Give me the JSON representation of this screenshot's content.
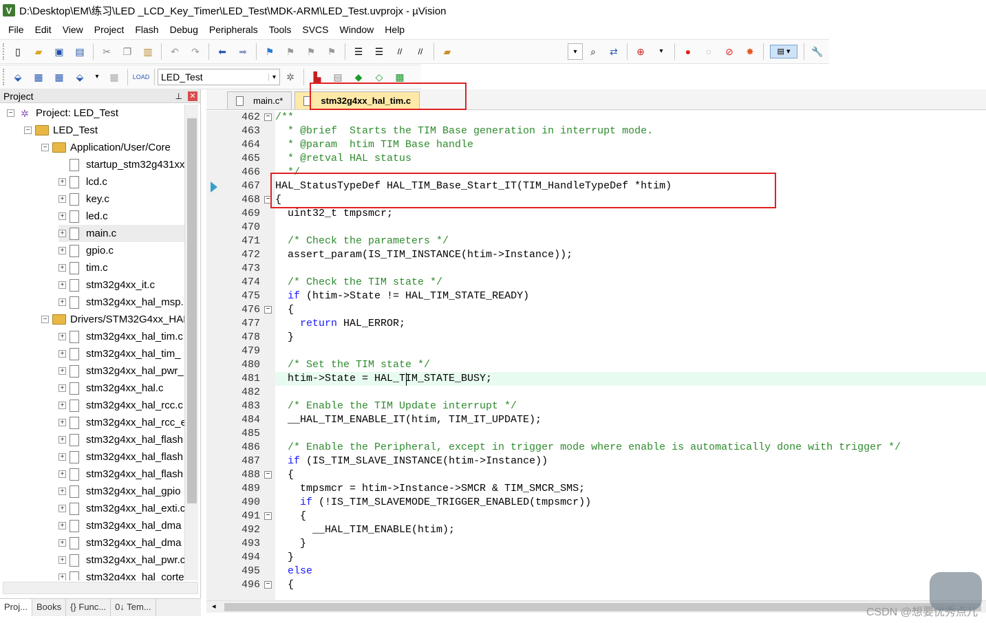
{
  "title": "D:\\Desktop\\EM\\练习\\LED _LCD_Key_Timer\\LED_Test\\MDK-ARM\\LED_Test.uvprojx - µVision",
  "app_icon": "V",
  "menu": [
    "File",
    "Edit",
    "View",
    "Project",
    "Flash",
    "Debug",
    "Peripherals",
    "Tools",
    "SVCS",
    "Window",
    "Help"
  ],
  "toolbar2": {
    "target": "LED_Test"
  },
  "project_panel": {
    "title": "Project",
    "tree": [
      {
        "label": "Project: LED_Test",
        "level": 0,
        "kind": "project",
        "exp": "−"
      },
      {
        "label": "LED_Test",
        "level": 1,
        "kind": "target",
        "exp": "−"
      },
      {
        "label": "Application/User/Core",
        "level": 2,
        "kind": "folder",
        "exp": "−"
      },
      {
        "label": "startup_stm32g431xx",
        "level": 3,
        "kind": "file",
        "exp": ""
      },
      {
        "label": "lcd.c",
        "level": 3,
        "kind": "file",
        "exp": "+"
      },
      {
        "label": "key.c",
        "level": 3,
        "kind": "file",
        "exp": "+"
      },
      {
        "label": "led.c",
        "level": 3,
        "kind": "file",
        "exp": "+"
      },
      {
        "label": "main.c",
        "level": 3,
        "kind": "file",
        "exp": "+",
        "sel": true
      },
      {
        "label": "gpio.c",
        "level": 3,
        "kind": "file",
        "exp": "+"
      },
      {
        "label": "tim.c",
        "level": 3,
        "kind": "file",
        "exp": "+"
      },
      {
        "label": "stm32g4xx_it.c",
        "level": 3,
        "kind": "file",
        "exp": "+"
      },
      {
        "label": "stm32g4xx_hal_msp.",
        "level": 3,
        "kind": "file",
        "exp": "+"
      },
      {
        "label": "Drivers/STM32G4xx_HAL",
        "level": 2,
        "kind": "folder",
        "exp": "−"
      },
      {
        "label": "stm32g4xx_hal_tim.c",
        "level": 3,
        "kind": "file",
        "exp": "+"
      },
      {
        "label": "stm32g4xx_hal_tim_",
        "level": 3,
        "kind": "file",
        "exp": "+"
      },
      {
        "label": "stm32g4xx_hal_pwr_",
        "level": 3,
        "kind": "file",
        "exp": "+"
      },
      {
        "label": "stm32g4xx_hal.c",
        "level": 3,
        "kind": "file",
        "exp": "+"
      },
      {
        "label": "stm32g4xx_hal_rcc.c",
        "level": 3,
        "kind": "file",
        "exp": "+"
      },
      {
        "label": "stm32g4xx_hal_rcc_e",
        "level": 3,
        "kind": "file",
        "exp": "+"
      },
      {
        "label": "stm32g4xx_hal_flash",
        "level": 3,
        "kind": "file",
        "exp": "+"
      },
      {
        "label": "stm32g4xx_hal_flash",
        "level": 3,
        "kind": "file",
        "exp": "+"
      },
      {
        "label": "stm32g4xx_hal_flash",
        "level": 3,
        "kind": "file",
        "exp": "+"
      },
      {
        "label": "stm32g4xx_hal_gpio",
        "level": 3,
        "kind": "file",
        "exp": "+"
      },
      {
        "label": "stm32g4xx_hal_exti.c",
        "level": 3,
        "kind": "file",
        "exp": "+"
      },
      {
        "label": "stm32g4xx_hal_dma",
        "level": 3,
        "kind": "file",
        "exp": "+"
      },
      {
        "label": "stm32g4xx_hal_dma",
        "level": 3,
        "kind": "file",
        "exp": "+"
      },
      {
        "label": "stm32g4xx_hal_pwr.c",
        "level": 3,
        "kind": "file",
        "exp": "+"
      },
      {
        "label": "stm32g4xx_hal_corte",
        "level": 3,
        "kind": "file",
        "exp": "+"
      }
    ]
  },
  "bottom_tabs": [
    "Proj...",
    "Books",
    "{} Func...",
    "0↓ Tem..."
  ],
  "editor": {
    "tabs": [
      {
        "label": "main.c*",
        "active": false
      },
      {
        "label": "stm32g4xx_hal_tim.c",
        "active": true
      }
    ],
    "lines": [
      {
        "n": "462",
        "fold": "−",
        "t": "/**",
        "c": "cm"
      },
      {
        "n": "463",
        "fold": "",
        "t": "  * @brief  Starts the TIM Base generation in interrupt mode.",
        "c": "cm"
      },
      {
        "n": "464",
        "fold": "",
        "t": "  * @param  htim TIM Base handle",
        "c": "cm"
      },
      {
        "n": "465",
        "fold": "",
        "t": "  * @retval HAL status",
        "c": "cm"
      },
      {
        "n": "466",
        "fold": "",
        "t": "  */",
        "c": "cm"
      },
      {
        "n": "467",
        "fold": "",
        "t": "HAL_StatusTypeDef HAL_TIM_Base_Start_IT(TIM_HandleTypeDef *htim)",
        "c": ""
      },
      {
        "n": "468",
        "fold": "−",
        "t": "{",
        "c": ""
      },
      {
        "n": "469",
        "fold": "",
        "t": "  uint32_t tmpsmcr;",
        "c": ""
      },
      {
        "n": "470",
        "fold": "",
        "t": "",
        "c": ""
      },
      {
        "n": "471",
        "fold": "",
        "t": "  /* Check the parameters */",
        "c": "cm"
      },
      {
        "n": "472",
        "fold": "",
        "t": "  assert_param(IS_TIM_INSTANCE(htim->Instance));",
        "c": ""
      },
      {
        "n": "473",
        "fold": "",
        "t": "",
        "c": ""
      },
      {
        "n": "474",
        "fold": "",
        "t": "  /* Check the TIM state */",
        "c": "cm"
      },
      {
        "n": "475",
        "fold": "",
        "t": "  if (htim->State != HAL_TIM_STATE_READY)",
        "c": "if"
      },
      {
        "n": "476",
        "fold": "−",
        "t": "  {",
        "c": ""
      },
      {
        "n": "477",
        "fold": "",
        "t": "    return HAL_ERROR;",
        "c": "ret"
      },
      {
        "n": "478",
        "fold": "",
        "t": "  }",
        "c": ""
      },
      {
        "n": "479",
        "fold": "",
        "t": "",
        "c": ""
      },
      {
        "n": "480",
        "fold": "",
        "t": "  /* Set the TIM state */",
        "c": "cm"
      },
      {
        "n": "481",
        "fold": "",
        "t": "  htim->State = HAL_TIM_STATE_BUSY;",
        "c": "hl"
      },
      {
        "n": "482",
        "fold": "",
        "t": "",
        "c": ""
      },
      {
        "n": "483",
        "fold": "",
        "t": "  /* Enable the TIM Update interrupt */",
        "c": "cm"
      },
      {
        "n": "484",
        "fold": "",
        "t": "  __HAL_TIM_ENABLE_IT(htim, TIM_IT_UPDATE);",
        "c": ""
      },
      {
        "n": "485",
        "fold": "",
        "t": "",
        "c": ""
      },
      {
        "n": "486",
        "fold": "",
        "t": "  /* Enable the Peripheral, except in trigger mode where enable is automatically done with trigger */",
        "c": "cm"
      },
      {
        "n": "487",
        "fold": "",
        "t": "  if (IS_TIM_SLAVE_INSTANCE(htim->Instance))",
        "c": "if"
      },
      {
        "n": "488",
        "fold": "−",
        "t": "  {",
        "c": ""
      },
      {
        "n": "489",
        "fold": "",
        "t": "    tmpsmcr = htim->Instance->SMCR & TIM_SMCR_SMS;",
        "c": ""
      },
      {
        "n": "490",
        "fold": "",
        "t": "    if (!IS_TIM_SLAVEMODE_TRIGGER_ENABLED(tmpsmcr))",
        "c": "if4"
      },
      {
        "n": "491",
        "fold": "−",
        "t": "    {",
        "c": ""
      },
      {
        "n": "492",
        "fold": "",
        "t": "      __HAL_TIM_ENABLE(htim);",
        "c": ""
      },
      {
        "n": "493",
        "fold": "",
        "t": "    }",
        "c": ""
      },
      {
        "n": "494",
        "fold": "",
        "t": "  }",
        "c": ""
      },
      {
        "n": "495",
        "fold": "",
        "t": "  else",
        "c": "kw"
      },
      {
        "n": "496",
        "fold": "−",
        "t": "  {",
        "c": ""
      }
    ]
  },
  "watermark": "CSDN @想要优秀点儿"
}
